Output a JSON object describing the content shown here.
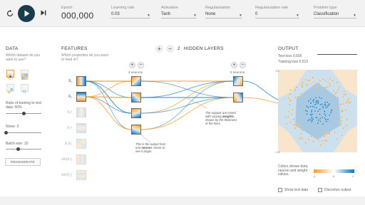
{
  "controls": {
    "epoch_label": "Epoch",
    "epoch_value": "000,000",
    "learning_rate_label": "Learning rate",
    "learning_rate_value": "0.03",
    "activation_label": "Activation",
    "activation_value": "Tanh",
    "regularization_label": "Regularization",
    "regularization_value": "None",
    "regularization_rate_label": "Regularization rate",
    "regularization_rate_value": "0",
    "problem_type_label": "Problem type",
    "problem_type_value": "Classification"
  },
  "data_panel": {
    "title": "DATA",
    "question": "Which dataset do you want to use?",
    "ratio_label": "Ratio of training to test data:",
    "ratio_value": "50%",
    "ratio_fraction": 0.5,
    "noise_label": "Noise:",
    "noise_value": "0",
    "noise_fraction": 0.0,
    "batch_label": "Batch size:",
    "batch_value": "10",
    "batch_fraction": 0.35,
    "regenerate_label": "REGENERATE"
  },
  "features_panel": {
    "title": "FEATURES",
    "question": "Which properties do you want to feed in?",
    "features": [
      {
        "label": "X₁",
        "active": true
      },
      {
        "label": "X₂",
        "active": true
      },
      {
        "label": "X₁²",
        "active": false
      },
      {
        "label": "X₂²",
        "active": false
      },
      {
        "label": "X₁X₂",
        "active": false
      },
      {
        "label": "sin(X₁)",
        "active": false
      },
      {
        "label": "sin(X₂)",
        "active": false
      }
    ]
  },
  "network": {
    "plus": "+",
    "minus": "−",
    "layers_count": "2",
    "layers_label": "HIDDEN LAYERS",
    "layer1_neurons": "4 neurons",
    "layer2_neurons": "2 neurons",
    "annotation_weights_1": "The outputs are mixed with varying",
    "annotation_weights_2": "weights",
    "annotation_weights_3": ", shown by the thickness of the lines.",
    "annotation_neuron_1": "This is the output from one",
    "annotation_neuron_2": "neuron",
    "annotation_neuron_3": ". Hover to see it larger."
  },
  "output_panel": {
    "title": "OUTPUT",
    "test_loss": "Test loss 0.505",
    "training_loss": "Training loss 0.513",
    "legend_text": "Colors shows data, neuron and weight values.",
    "legend_min": "-1",
    "legend_mid": "0",
    "legend_max": "1",
    "show_test_data": "Show test data",
    "discretize_output": "Discretize output"
  },
  "colors": {
    "orange": "#f59d2a",
    "blue": "#0877bd",
    "dark": "#183d4e"
  }
}
